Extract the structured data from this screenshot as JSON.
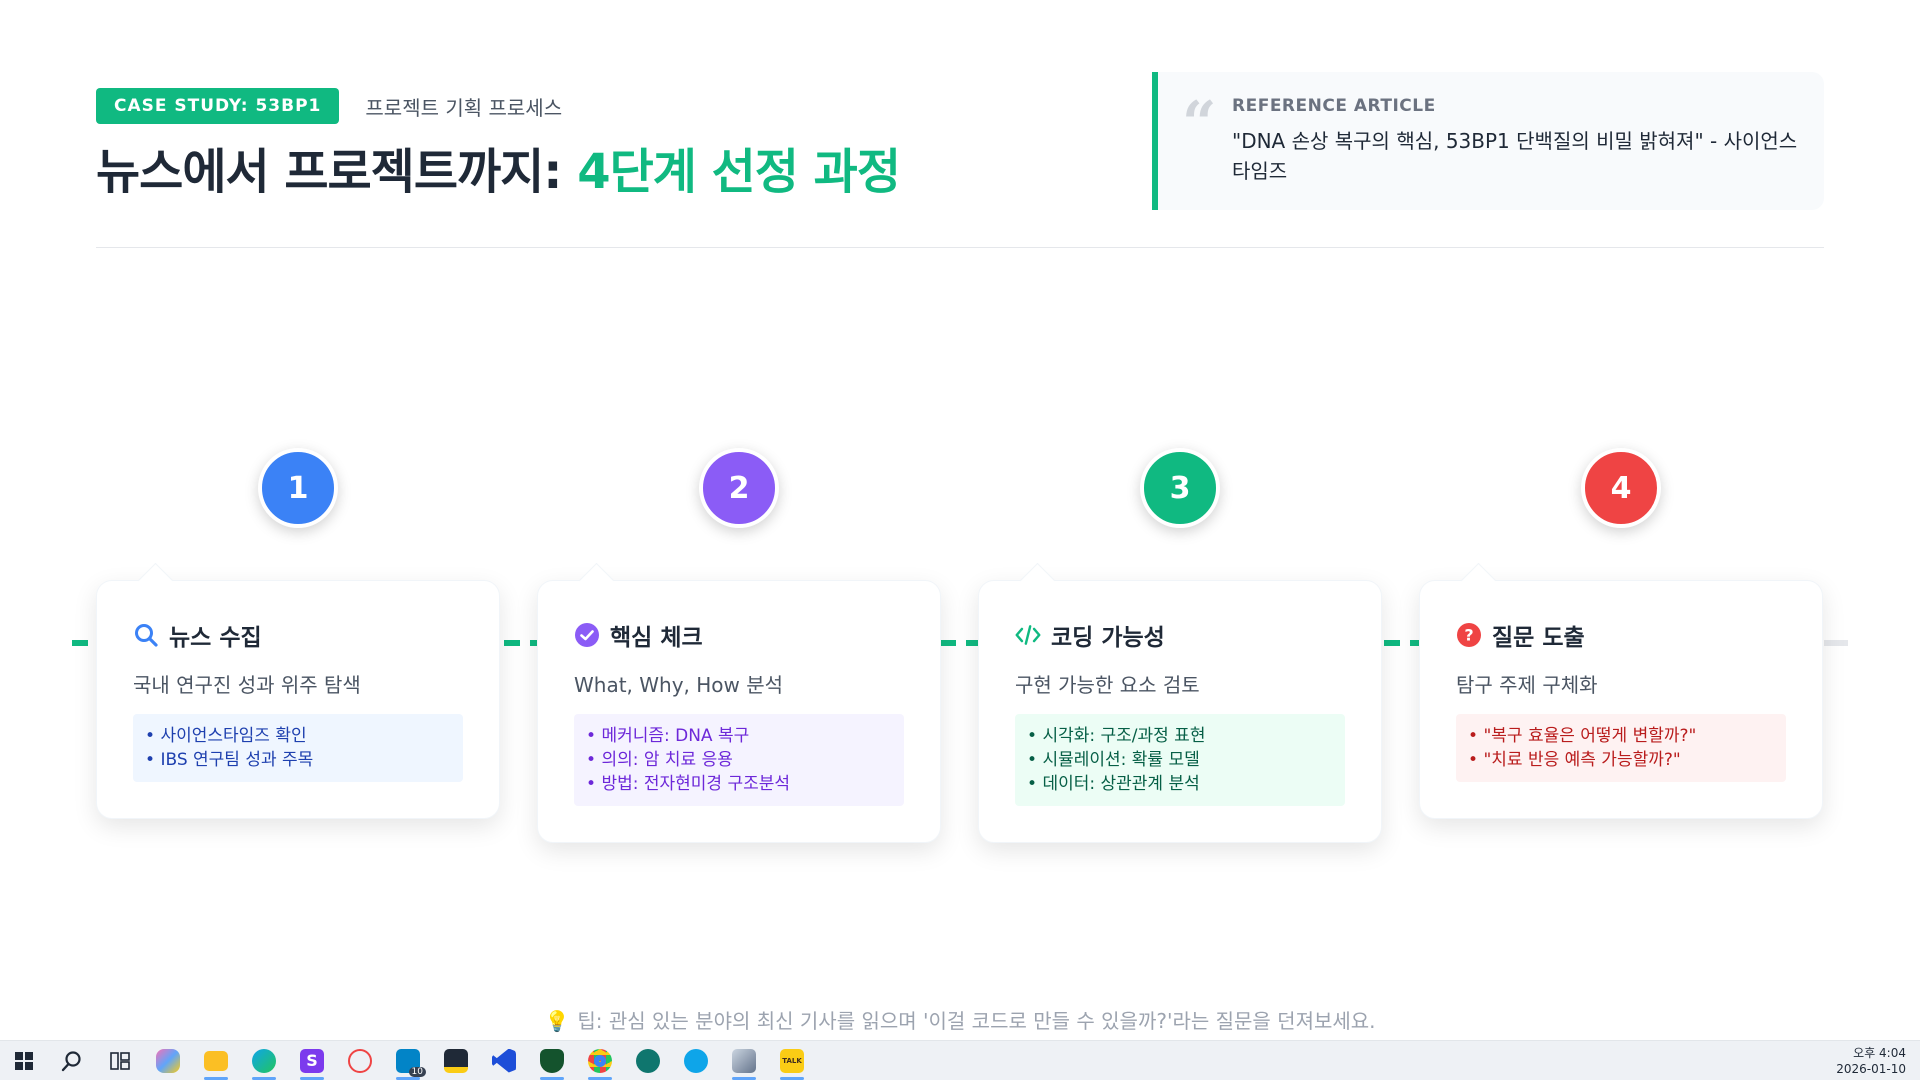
{
  "header": {
    "badge": "CASE STUDY: 53BP1",
    "subtitle": "프로젝트 기획 프로세스",
    "title_main": "뉴스에서 프로젝트까지: ",
    "title_accent": "4단계 선정 과정",
    "reference": {
      "label": "REFERENCE ARTICLE",
      "text": "\"DNA 손상 복구의 핵심, 53BP1 단백질의 비밀 밝혀져\" - 사이언스타임즈"
    }
  },
  "steps": [
    {
      "number": "1",
      "color": "#3b82f6",
      "icon": "search-icon",
      "title": "뉴스 수집",
      "description": "국내 연구진 성과 위주 탐색",
      "items": [
        "사이언스타임즈 확인",
        "IBS 연구팀 성과 주목"
      ]
    },
    {
      "number": "2",
      "color": "#8b5cf6",
      "icon": "check-circle-icon",
      "title": "핵심 체크",
      "description": "What, Why, How 분석",
      "items": [
        "메커니즘: DNA 복구",
        "의의: 암 치료 응용",
        "방법: 전자현미경 구조분석"
      ]
    },
    {
      "number": "3",
      "color": "#10b981",
      "icon": "code-icon",
      "title": "코딩 가능성",
      "description": "구현 가능한 요소 검토",
      "items": [
        "시각화: 구조/과정 표현",
        "시뮬레이션: 확률 모델",
        "데이터: 상관관계 분석"
      ]
    },
    {
      "number": "4",
      "color": "#ef4444",
      "icon": "question-circle-icon",
      "title": "질문 도출",
      "description": "탐구 주제 구체화",
      "items": [
        "\"복구 효율은 어떻게 변할까?\"",
        "\"치료 반응 예측 가능할까?\""
      ]
    }
  ],
  "tip": "팁: 관심 있는 분야의 최신 기사를 읽으며 '이걸 코드로 만들 수 있을까?'라는 질문을 던져보세요.",
  "taskbar": {
    "icons": [
      "windows-start-icon",
      "search-icon",
      "task-view-icon",
      "copilot-icon",
      "file-explorer-icon",
      "edge-icon",
      "app-s-icon",
      "app-swirl-icon",
      "remote-desktop-icon",
      "sticky-notes-icon",
      "vscode-icon",
      "app-shield-icon",
      "chrome-icon",
      "app-bird-icon",
      "app-fish-icon",
      "app-drive-icon",
      "kakaotalk-icon"
    ],
    "badge_count": "10",
    "time": "오후 4:04",
    "date": "2026-01-10"
  }
}
